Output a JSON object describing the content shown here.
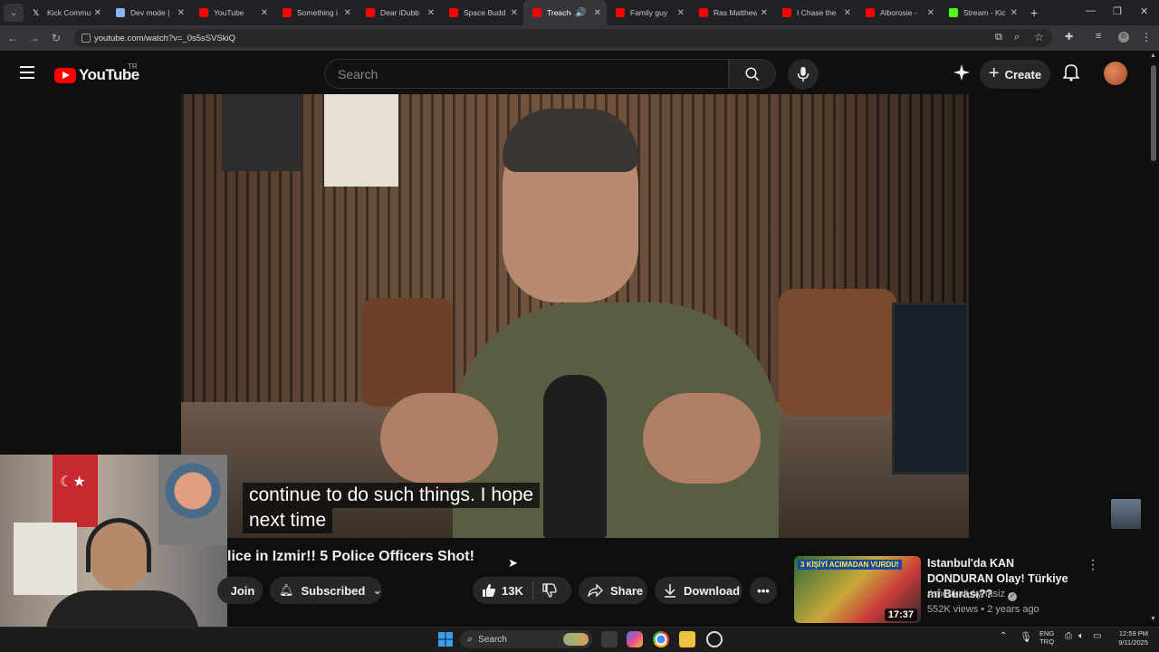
{
  "browser": {
    "tabs": [
      {
        "label": "Kick Commu",
        "favicon_color": "#ffffff",
        "icon": "x-logo-icon"
      },
      {
        "label": "Dev mode |",
        "favicon_color": "#8ab4f8",
        "icon": "document-icon"
      },
      {
        "label": "YouTube",
        "favicon_color": "#ff0000",
        "icon": "youtube-icon"
      },
      {
        "label": "Something i",
        "favicon_color": "#ff0000",
        "icon": "youtube-icon"
      },
      {
        "label": "Dear iDubb",
        "favicon_color": "#ff0000",
        "icon": "youtube-icon"
      },
      {
        "label": "Space Budd",
        "favicon_color": "#ff0000",
        "icon": "youtube-icon"
      },
      {
        "label": "Treacher",
        "favicon_color": "#ff0000",
        "icon": "youtube-icon",
        "active": true
      },
      {
        "label": "Family guy",
        "favicon_color": "#ff0000",
        "icon": "youtube-icon"
      },
      {
        "label": "Ras Matthew",
        "favicon_color": "#ff0000",
        "icon": "youtube-icon"
      },
      {
        "label": "I Chase the",
        "favicon_color": "#ff0000",
        "icon": "youtube-icon"
      },
      {
        "label": "Alborosie -",
        "favicon_color": "#ff0000",
        "icon": "youtube-icon"
      },
      {
        "label": "Stream - Kic",
        "favicon_color": "#53fc18",
        "icon": "kick-icon"
      }
    ],
    "url": "youtube.com/watch?v=_0s5sSVSkiQ"
  },
  "youtube": {
    "logo_text": "YouTube",
    "country_code": "TR",
    "search_placeholder": "Search",
    "create_label": "Create"
  },
  "video": {
    "caption_line1": "continue to do such things.  I hope",
    "caption_line2": "next time",
    "title": "lice in Izmir!! 5 Police Officers Shot!",
    "join_label": "Join",
    "subscribed_label": "Subscribed",
    "like_count": "13K",
    "share_label": "Share",
    "download_label": "Download"
  },
  "recommendation": {
    "title": "Istanbul'da KAN DONDURAN Olay! Türkiye mi Burası??",
    "channel": "Amerikali Aynasiz",
    "meta": "552K views • 2 years ago",
    "duration": "17:37",
    "thumb_text": "3 KİŞİYİ ACIMADAN VURDU!"
  },
  "taskbar": {
    "search_label": "Search",
    "lang_line1": "ENG",
    "lang_line2": "TRQ",
    "time": "12:59 PM",
    "date": "9/11/2025"
  },
  "colors": {
    "yt_red": "#ff0000",
    "background": "#0f0f0f",
    "pill": "#272727"
  }
}
